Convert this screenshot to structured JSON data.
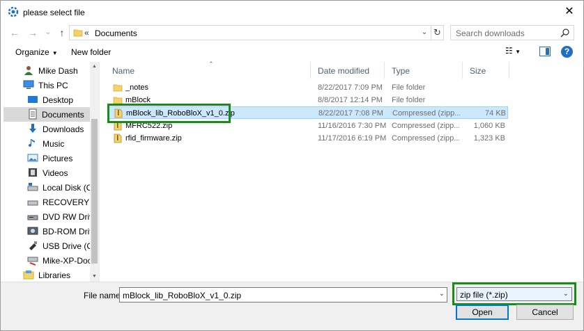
{
  "window": {
    "title": "please select file",
    "close": "✕"
  },
  "nav": {
    "back": "←",
    "forward": "→",
    "history": "⌄",
    "up": "↑",
    "address_sep": "«",
    "address_path": "Documents",
    "search_placeholder": "Search downloads"
  },
  "toolbar": {
    "organize": "Organize",
    "new_folder": "New folder",
    "help": "?"
  },
  "sidebar": {
    "items": [
      {
        "label": "Mike Dash",
        "icon": "user-icon"
      },
      {
        "label": "This PC",
        "icon": "computer-icon"
      },
      {
        "label": "Desktop",
        "icon": "desktop-icon"
      },
      {
        "label": "Documents",
        "icon": "documents-icon",
        "selected": true
      },
      {
        "label": "Downloads",
        "icon": "downloads-icon"
      },
      {
        "label": "Music",
        "icon": "music-icon"
      },
      {
        "label": "Pictures",
        "icon": "pictures-icon"
      },
      {
        "label": "Videos",
        "icon": "videos-icon"
      },
      {
        "label": "Local Disk (C:)",
        "icon": "local-disk-icon"
      },
      {
        "label": "RECOVERY (D:)",
        "icon": "drive-icon"
      },
      {
        "label": "DVD RW Drive",
        "icon": "dvd-drive-icon"
      },
      {
        "label": "BD-ROM Drive",
        "icon": "bd-drive-icon"
      },
      {
        "label": "USB Drive (G:)",
        "icon": "usb-drive-icon"
      },
      {
        "label": "Mike-XP-Docu",
        "icon": "network-drive-icon"
      },
      {
        "label": "Libraries",
        "icon": "libraries-icon"
      }
    ]
  },
  "file_list": {
    "columns": [
      "Name",
      "Date modified",
      "Type",
      "Size"
    ],
    "rows": [
      {
        "name": "_notes",
        "date": "8/22/2017 7:09 PM",
        "type": "File folder",
        "size": "",
        "kind": "folder"
      },
      {
        "name": "mBlock",
        "date": "8/8/2017 12:14 PM",
        "type": "File folder",
        "size": "",
        "kind": "folder"
      },
      {
        "name": "mBlock_lib_RoboBloX_v1_0.zip",
        "date": "8/22/2017 7:08 PM",
        "type": "Compressed (zipp...",
        "size": "74 KB",
        "kind": "zip",
        "selected": true
      },
      {
        "name": "MFRC522.zip",
        "date": "11/16/2016 7:30 PM",
        "type": "Compressed (zipp...",
        "size": "1,060 KB",
        "kind": "zip"
      },
      {
        "name": "rfid_firmware.zip",
        "date": "11/17/2016 6:19 PM",
        "type": "Compressed (zipp...",
        "size": "1,323 KB",
        "kind": "zip"
      }
    ]
  },
  "footer": {
    "file_name_label": "File name:",
    "file_name_value": "mBlock_lib_RoboBloX_v1_0.zip",
    "filter_value": "zip file (*.zip)",
    "open_label": "Open",
    "cancel_label": "Cancel"
  },
  "colors": {
    "accent": "#0078d7",
    "selection": "#cce8ff",
    "highlight_box": "#1a8a1a"
  }
}
